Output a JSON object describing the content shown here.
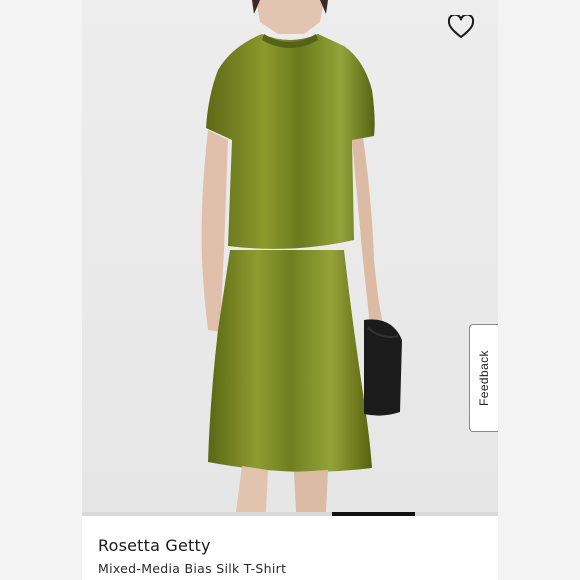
{
  "product": {
    "brand": "Rosetta Getty",
    "name": "Mixed-Media Bias Silk T-Shirt"
  },
  "gallery": {
    "progress": 0.2,
    "progress_offset": 0.6
  },
  "feedback_tab": {
    "label": "Feedback"
  },
  "icons": {
    "favorite": "heart-outline-icon"
  },
  "colors": {
    "garment": "#6b7a1e",
    "accent": "#111111",
    "background": "#f3f3f3"
  }
}
